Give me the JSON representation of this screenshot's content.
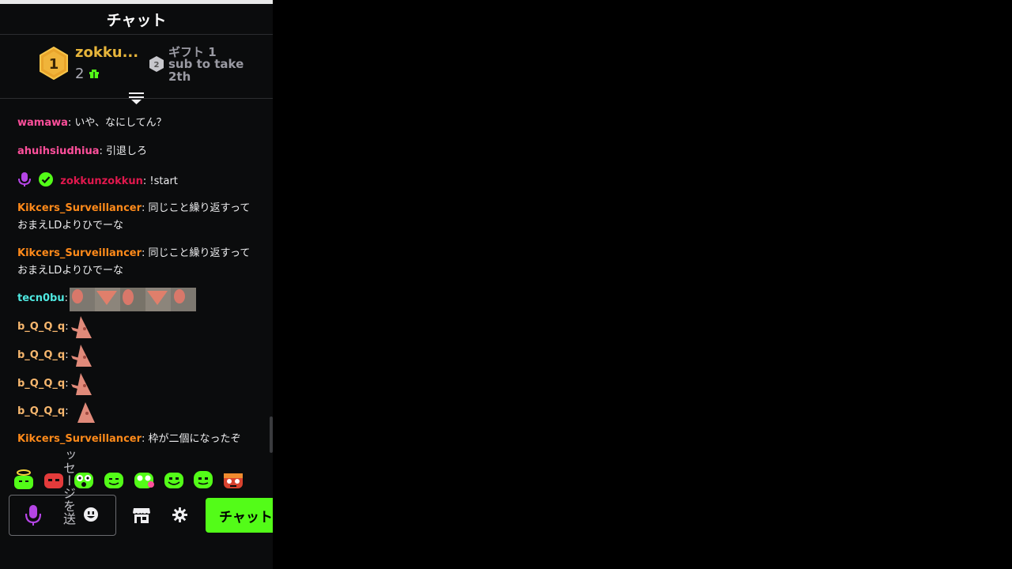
{
  "header": {
    "title": "チャット"
  },
  "leaderboard": {
    "first": {
      "rank": "1",
      "name": "zokku...",
      "count": "2"
    },
    "second": {
      "rank": "2",
      "title": "ギフト 1",
      "line1": "sub to take",
      "line2": "2th"
    }
  },
  "messages": [
    {
      "user": "wamawa",
      "text": ": いや、なにしてん？"
    },
    {
      "user": "ahuihsiudhiua",
      "text": ": 引退しろ"
    },
    {
      "user": "zokkunzokkun",
      "text": ": !start"
    },
    {
      "user": "Kikcers_Surveillancer",
      "text": ": 同じこと繰り返すって",
      "text2": "おまえLDよりひでーな"
    },
    {
      "user": "Kikcers_Surveillancer",
      "text": ": 同じこと繰り返すって",
      "text2": "おまえLDよりひでーな"
    },
    {
      "user": "tecn0bu",
      "text": ":"
    },
    {
      "user": "b_Q_Q_q",
      "text": ":"
    },
    {
      "user": "b_Q_Q_q",
      "text": ":"
    },
    {
      "user": "b_Q_Q_q",
      "text": ":"
    },
    {
      "user": "b_Q_Q_q",
      "text": ":"
    },
    {
      "user": "Kikcers_Surveillancer",
      "text": ": 枠が二個になったぞ"
    }
  ],
  "input": {
    "placeholder": "ッセージを送"
  },
  "send_button": {
    "label": "チャット"
  },
  "colors": {
    "accent": "#53fc18",
    "gold": "#e7b53b",
    "user_pink": "#ff4f9b",
    "user_red": "#e0184d",
    "user_orange": "#ff8a1a",
    "user_cyan": "#4fe8e0",
    "user_peach": "#f7b76e"
  },
  "icons": [
    "rank-1-badge-icon",
    "gift-icon",
    "rank-2-badge-icon",
    "collapse-icon",
    "mic-icon",
    "verified-icon",
    "emote-icon",
    "store-icon",
    "settings-icon"
  ]
}
